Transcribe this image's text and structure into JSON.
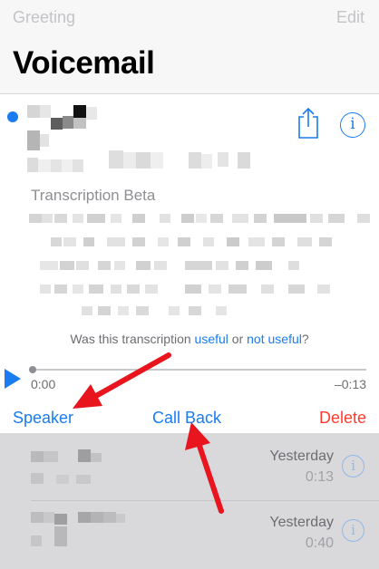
{
  "nav": {
    "greeting_label": "Greeting",
    "edit_label": "Edit",
    "title": "Voicemail"
  },
  "message": {
    "transcription_label": "Transcription Beta",
    "feedback": {
      "prefix": "Was this transcription ",
      "useful": "useful",
      "middle": " or ",
      "not_useful": "not useful",
      "suffix": "?"
    },
    "time_elapsed": "0:00",
    "time_remaining": "–0:13",
    "progress": 0
  },
  "actions": {
    "speaker": "Speaker",
    "call_back": "Call Back",
    "delete": "Delete"
  },
  "list": [
    {
      "date": "Yesterday",
      "duration": "0:13"
    },
    {
      "date": "Yesterday",
      "duration": "0:40"
    }
  ],
  "colors": {
    "accent": "#1a7cf0",
    "destructive": "#ff3b30",
    "annotation_arrow": "#e8141e"
  },
  "icons": {
    "share": "share-icon",
    "info": "info-icon",
    "play": "play-icon"
  }
}
